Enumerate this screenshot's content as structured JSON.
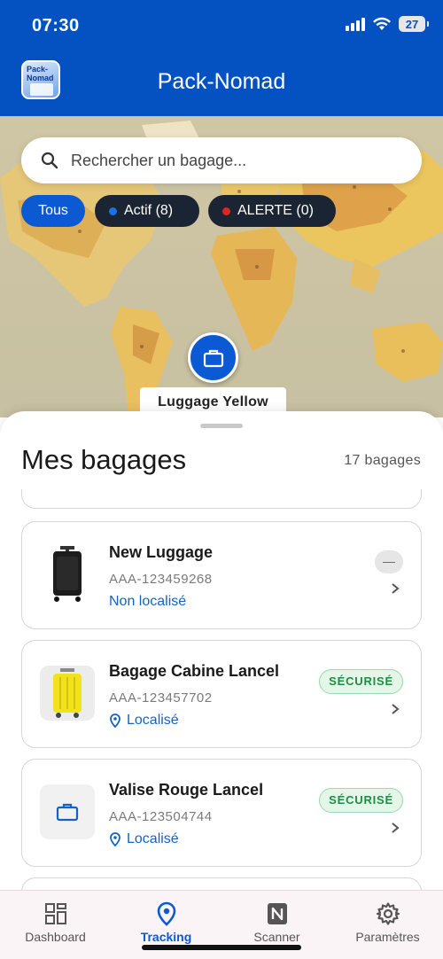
{
  "status_bar": {
    "time": "07:30",
    "battery": "27"
  },
  "header": {
    "title": "Pack-Nomad",
    "logo_text": "Pack-\nNomad"
  },
  "search": {
    "placeholder": "Rechercher un bagage..."
  },
  "filters": [
    {
      "label": "Tous",
      "selected": true
    },
    {
      "label": "Actif (8)",
      "dot_color": "#1e6fe6"
    },
    {
      "label": "ALERTE (0)",
      "dot_color": "#e02424"
    }
  ],
  "map_marker": {
    "label": "Luggage Yellow"
  },
  "sheet": {
    "title": "Mes bagages",
    "count": "17 bagages"
  },
  "luggage": [
    {
      "name": "New Luggage",
      "id": "AAA-123459268",
      "location": "Non localisé",
      "badge": "—",
      "thumb": "black-suitcase"
    },
    {
      "name": "Bagage Cabine Lancel",
      "id": "AAA-123457702",
      "location": "Localisé",
      "badge": "SÉCURISÉ",
      "thumb": "yellow-suitcase"
    },
    {
      "name": "Valise Rouge Lancel",
      "id": "AAA-123504744",
      "location": "Localisé",
      "badge": "SÉCURISÉ",
      "thumb": "briefcase-icon"
    }
  ],
  "nav": [
    {
      "label": "Dashboard",
      "icon": "dashboard-icon"
    },
    {
      "label": "Tracking",
      "icon": "location-pin-icon",
      "active": true
    },
    {
      "label": "Scanner",
      "icon": "nfc-icon"
    },
    {
      "label": "Paramètres",
      "icon": "gear-icon"
    }
  ],
  "colors": {
    "primary": "#0452c2",
    "accent": "#0b5ad4",
    "secure_green": "#1e8c45",
    "link_blue": "#1463c4"
  }
}
